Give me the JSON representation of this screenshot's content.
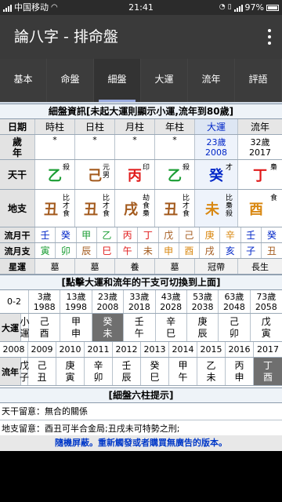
{
  "status": {
    "carrier": "中国移动",
    "time": "21:41",
    "battery": "97%"
  },
  "app": {
    "title": "論八字 - 排命盤"
  },
  "tabs": [
    {
      "label": "基本"
    },
    {
      "label": "命盤"
    },
    {
      "label": "細盤"
    },
    {
      "label": "大運"
    },
    {
      "label": "流年"
    },
    {
      "label": "評語"
    }
  ],
  "heading": "細盤資訊[未起大運則顯示小運,流年到80歲]",
  "headers": {
    "label": "日期",
    "cols": [
      "時柱",
      "日柱",
      "月柱",
      "年柱",
      "大運",
      "流年"
    ]
  },
  "age": {
    "label": "歲\n年",
    "vals": [
      "*",
      "*",
      "*",
      "*",
      "23歲\n2008",
      "32歲\n2017"
    ]
  },
  "tiangan": {
    "label": "天干",
    "vals": [
      {
        "c": "乙",
        "s": "殺",
        "k": "grn"
      },
      {
        "c": "己",
        "s": "元\n男",
        "k": "brn"
      },
      {
        "c": "丙",
        "s": "印",
        "k": "red"
      },
      {
        "c": "乙",
        "s": "殺",
        "k": "grn"
      },
      {
        "c": "癸",
        "s": "才",
        "k": "blu"
      },
      {
        "c": "丁",
        "s": "梟",
        "k": "red"
      }
    ]
  },
  "dizhi": {
    "label": "地支",
    "vals": [
      {
        "c": "丑",
        "s": "比\n才\n食",
        "k": "brn"
      },
      {
        "c": "丑",
        "s": "比\n才\n食",
        "k": "brn"
      },
      {
        "c": "戌",
        "s": "劫\n食\n梟",
        "k": "brn"
      },
      {
        "c": "丑",
        "s": "比\n才\n食",
        "k": "brn"
      },
      {
        "c": "未",
        "s": "比\n梟\n殺",
        "k": "org"
      },
      {
        "c": "酉",
        "s": "食",
        "k": "org"
      }
    ]
  },
  "liuyuegan": {
    "label": "流月干",
    "vals": [
      {
        "c": "壬",
        "k": "blu"
      },
      {
        "c": "癸",
        "k": "blu"
      },
      {
        "c": "甲",
        "k": "grn"
      },
      {
        "c": "乙",
        "k": "grn"
      },
      {
        "c": "丙",
        "k": "red"
      },
      {
        "c": "丁",
        "k": "red"
      },
      {
        "c": "戊",
        "k": "brn"
      },
      {
        "c": "己",
        "k": "brn"
      },
      {
        "c": "庚",
        "k": "org"
      },
      {
        "c": "辛",
        "k": "org"
      },
      {
        "c": "壬",
        "k": "blu"
      },
      {
        "c": "癸",
        "k": "blu"
      }
    ]
  },
  "liuyuezhi": {
    "label": "流月支",
    "vals": [
      {
        "c": "寅",
        "k": "grn"
      },
      {
        "c": "卯",
        "k": "grn"
      },
      {
        "c": "辰",
        "k": "brn"
      },
      {
        "c": "巳",
        "k": "red"
      },
      {
        "c": "午",
        "k": "red"
      },
      {
        "c": "未",
        "k": "brn"
      },
      {
        "c": "申",
        "k": "org"
      },
      {
        "c": "酉",
        "k": "org"
      },
      {
        "c": "戌",
        "k": "brn"
      },
      {
        "c": "亥",
        "k": "blu"
      },
      {
        "c": "子",
        "k": "blu"
      },
      {
        "c": "丑",
        "k": "brn"
      }
    ]
  },
  "xingyun": {
    "label": "星運",
    "vals": [
      "墓",
      "墓",
      "養",
      "墓",
      "冠帶",
      "長生"
    ]
  },
  "click_hint": "[點擊大運和流年的干支可切換到上面]",
  "dayun_ages": [
    "0-2",
    "3歲\n1988",
    "13歲\n1998",
    "23歲\n2008",
    "33歲\n2018",
    "43歲\n2028",
    "53歲\n2038",
    "63歲\n2048",
    "73歲\n2058"
  ],
  "dayun": {
    "label": "大運",
    "vals": [
      "小\n運",
      "己\n酉",
      "甲\n申",
      "癸\n未",
      "壬\n午",
      "辛\n巳",
      "庚\n辰",
      "己\n卯",
      "戊\n寅"
    ]
  },
  "years": [
    "2008",
    "2009",
    "2010",
    "2011",
    "2012",
    "2013",
    "2014",
    "2015",
    "2016",
    "2017"
  ],
  "liunian": {
    "label": "流年",
    "vals": [
      "戊\n子",
      "己\n丑",
      "庚\n寅",
      "辛\n卯",
      "壬\n辰",
      "癸\n巳",
      "甲\n午",
      "乙\n未",
      "丙\n申",
      "丁\n酉"
    ]
  },
  "tips_heading": "[細盤六柱提示]",
  "tips": [
    "天干留意：無合的關係",
    "地支留意：酉丑可半合金局;丑戌未可特勢之刑;"
  ],
  "banner": "隨機屏蔽。重新觸發或者購買無廣告的版本。"
}
